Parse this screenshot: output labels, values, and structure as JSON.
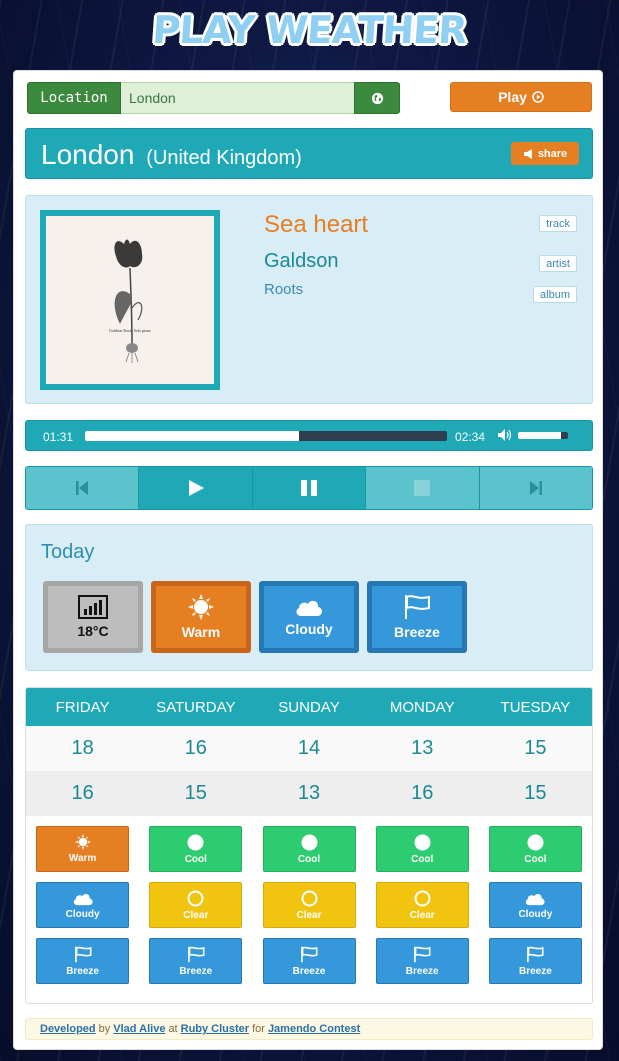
{
  "logo": {
    "text": "PLAY WEATHER"
  },
  "location": {
    "label": "Location",
    "value": "London",
    "locate_icon": "globe-icon"
  },
  "play_button": {
    "label": "Play",
    "icon": "play-circle-icon"
  },
  "city": {
    "name": "London",
    "country": "(United Kingdom)",
    "share_label": "share",
    "share_icon": "bullhorn-icon"
  },
  "track": {
    "title": "Sea heart",
    "artist": "Galdson",
    "album": "Roots",
    "tag_track": "track",
    "tag_artist": "artist",
    "tag_album": "album",
    "cover_text": "Galdson   Roots   Solo piano"
  },
  "player": {
    "elapsed": "01:31",
    "duration": "02:34",
    "progress_fraction": 0.59,
    "volume_fraction": 0.85,
    "volume_icon": "volume-icon"
  },
  "controls": [
    "step-backward-icon",
    "play-icon",
    "pause-icon",
    "stop-icon",
    "step-forward-icon"
  ],
  "today": {
    "title": "Today",
    "tiles": [
      {
        "label": "18°C",
        "icon": "signal-bars-icon",
        "color": "#bdbdbd"
      },
      {
        "label": "Warm",
        "icon": "sun-icon",
        "color": "#e67e22"
      },
      {
        "label": "Cloudy",
        "icon": "cloud-icon",
        "color": "#3498db"
      },
      {
        "label": "Breeze",
        "icon": "flag-icon",
        "color": "#3498db"
      }
    ]
  },
  "forecast": {
    "days": [
      "FRIDAY",
      "SATURDAY",
      "SUNDAY",
      "MONDAY",
      "TUESDAY"
    ],
    "high": [
      "18",
      "16",
      "14",
      "13",
      "15"
    ],
    "low": [
      "16",
      "15",
      "13",
      "16",
      "15"
    ],
    "conditions": [
      [
        {
          "label": "Warm",
          "icon": "sun-icon",
          "color": "orange"
        },
        {
          "label": "Cloudy",
          "icon": "cloud-icon",
          "color": "blue"
        },
        {
          "label": "Breeze",
          "icon": "flag-icon",
          "color": "blue"
        }
      ],
      [
        {
          "label": "Cool",
          "icon": "circle-icon",
          "color": "green"
        },
        {
          "label": "Clear",
          "icon": "ring-icon",
          "color": "yellow"
        },
        {
          "label": "Breeze",
          "icon": "flag-icon",
          "color": "blue"
        }
      ],
      [
        {
          "label": "Cool",
          "icon": "circle-icon",
          "color": "green"
        },
        {
          "label": "Clear",
          "icon": "ring-icon",
          "color": "yellow"
        },
        {
          "label": "Breeze",
          "icon": "flag-icon",
          "color": "blue"
        }
      ],
      [
        {
          "label": "Cool",
          "icon": "circle-icon",
          "color": "green"
        },
        {
          "label": "Clear",
          "icon": "ring-icon",
          "color": "yellow"
        },
        {
          "label": "Breeze",
          "icon": "flag-icon",
          "color": "blue"
        }
      ],
      [
        {
          "label": "Cool",
          "icon": "circle-icon",
          "color": "green"
        },
        {
          "label": "Cloudy",
          "icon": "cloud-icon",
          "color": "blue"
        },
        {
          "label": "Breeze",
          "icon": "flag-icon",
          "color": "blue"
        }
      ]
    ]
  },
  "footer": {
    "developed": "Developed",
    "by": "by",
    "author": "Vlad Alive",
    "at": "at",
    "company": "Ruby Cluster",
    "for": "for",
    "contest": "Jamendo Contest"
  },
  "colors": {
    "teal": "#1fa9b7",
    "orange": "#e67e22",
    "green": "#3b8a3d",
    "blue": "#3498db"
  }
}
